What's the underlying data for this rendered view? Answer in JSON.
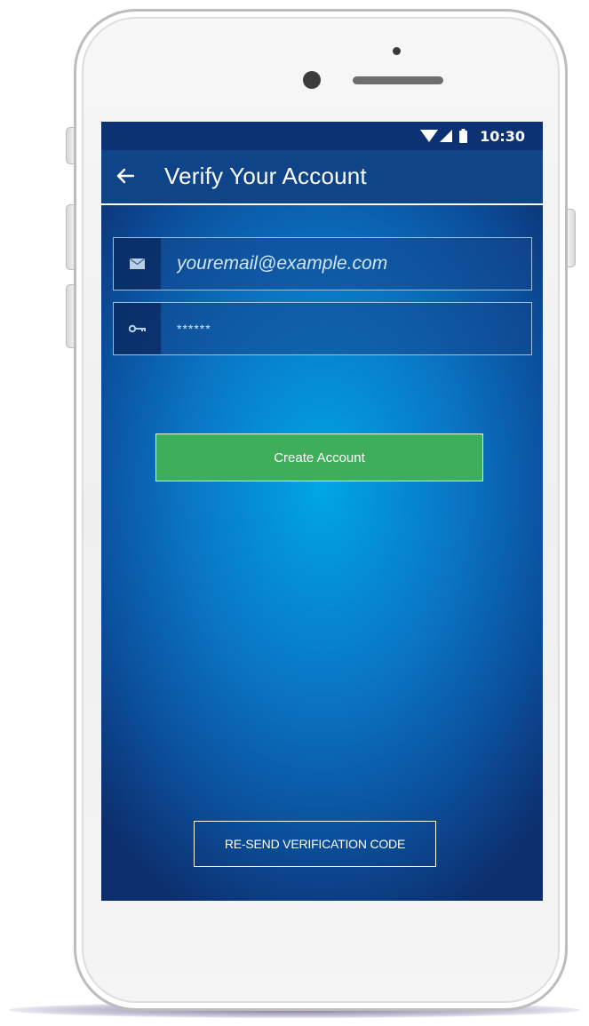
{
  "status_bar": {
    "time": "10:30",
    "icons": [
      "wifi-icon",
      "signal-icon",
      "battery-icon"
    ]
  },
  "app_bar": {
    "back_icon": "arrow-left-icon",
    "title": "Verify Your Account"
  },
  "form": {
    "email": {
      "icon": "mail-icon",
      "placeholder": "youremail@example.com",
      "value": ""
    },
    "password": {
      "icon": "key-icon",
      "placeholder": "******",
      "value": ""
    },
    "create_button_label": "Create Account",
    "resend_button_label": "RE-SEND VERIFICATION CODE"
  },
  "colors": {
    "status_bar": "#0d3273",
    "app_bar": "#0f4488",
    "screen_center": "#00a6e4",
    "screen_edge": "#0d2f6e",
    "primary_button": "#3fae5a"
  }
}
